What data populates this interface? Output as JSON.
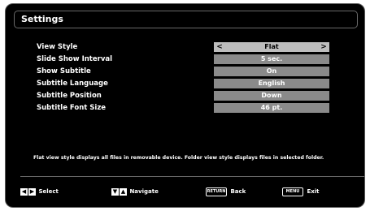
{
  "title": "Settings",
  "rows": [
    {
      "label": "View Style",
      "value": "Flat"
    },
    {
      "label": "Slide Show Interval",
      "value": "5 sec."
    },
    {
      "label": "Show Subtitle",
      "value": "On"
    },
    {
      "label": "Subtitle Language",
      "value": "English"
    },
    {
      "label": "Subtitle Position",
      "value": "Down"
    },
    {
      "label": "Subtitle Font Size",
      "value": "46 pt."
    }
  ],
  "selector_arrows": {
    "left": "<",
    "right": ">"
  },
  "info_text": "Flat view style displays all files in removable device. Folder view style displays files in selected folder.",
  "footer": {
    "select": "Select",
    "navigate": "Navigate",
    "return_key": "RETURN",
    "back": "Back",
    "menu_key": "MENU",
    "exit": "Exit"
  },
  "colors": {
    "background": "#000000",
    "value_box": "#8a8a8a",
    "selected_value_box": "#bdbdbd"
  }
}
